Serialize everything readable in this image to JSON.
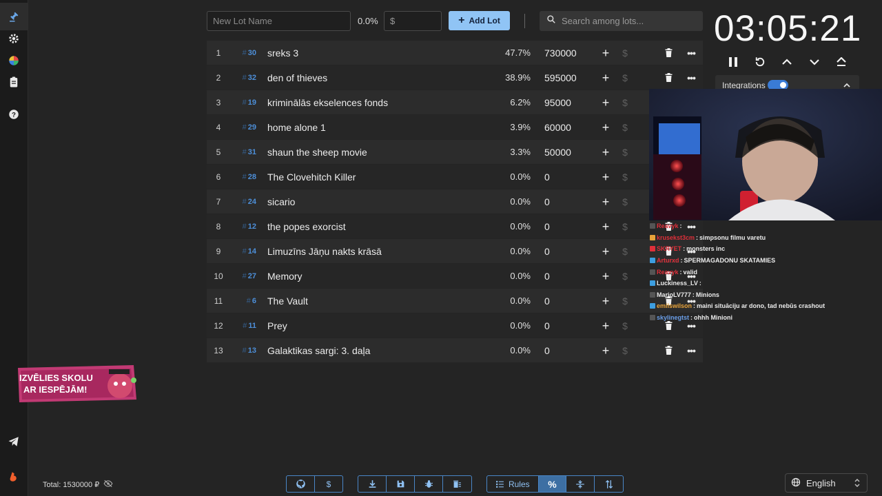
{
  "toolbar": {
    "lot_name_placeholder": "New Lot Name",
    "percent": "0.0%",
    "amount_placeholder": "$",
    "add_lot_label": "Add Lot",
    "search_placeholder": "Search among lots..."
  },
  "timer": {
    "display": "03:05:21"
  },
  "integrations": {
    "label": "Integrations",
    "enabled": true
  },
  "lots": [
    {
      "index": "1",
      "id": "30",
      "name": "sreks 3",
      "percent": "47.7%",
      "amount": "730000"
    },
    {
      "index": "2",
      "id": "32",
      "name": "den of thieves",
      "percent": "38.9%",
      "amount": "595000"
    },
    {
      "index": "3",
      "id": "19",
      "name": "kriminālās ekselences fonds",
      "percent": "6.2%",
      "amount": "95000"
    },
    {
      "index": "4",
      "id": "29",
      "name": "home alone 1",
      "percent": "3.9%",
      "amount": "60000"
    },
    {
      "index": "5",
      "id": "31",
      "name": "shaun the sheep movie",
      "percent": "3.3%",
      "amount": "50000"
    },
    {
      "index": "6",
      "id": "28",
      "name": "The Clovehitch Killer",
      "percent": "0.0%",
      "amount": "0"
    },
    {
      "index": "7",
      "id": "24",
      "name": "sicario",
      "percent": "0.0%",
      "amount": "0"
    },
    {
      "index": "8",
      "id": "12",
      "name": "the popes exorcist",
      "percent": "0.0%",
      "amount": "0"
    },
    {
      "index": "9",
      "id": "14",
      "name": "Limuzīns Jāņu nakts krāsā",
      "percent": "0.0%",
      "amount": "0"
    },
    {
      "index": "10",
      "id": "27",
      "name": "Memory",
      "percent": "0.0%",
      "amount": "0"
    },
    {
      "index": "11",
      "id": "6",
      "name": "The Vault",
      "percent": "0.0%",
      "amount": "0"
    },
    {
      "index": "12",
      "id": "11",
      "name": "Prey",
      "percent": "0.0%",
      "amount": "0"
    },
    {
      "index": "13",
      "id": "13",
      "name": "Galaktikas sargi: 3. daļa",
      "percent": "0.0%",
      "amount": "0"
    }
  ],
  "chat": [
    {
      "user": "Reavyk",
      "user_color": "#e0303a",
      "message": ""
    },
    {
      "user": "krusekst3cm",
      "user_color": "#e0303a",
      "message": "simpsonu filmu varetu"
    },
    {
      "user": "SKRYET",
      "user_color": "#e0303a",
      "message": "monsters inc"
    },
    {
      "user": "Arturxd",
      "user_color": "#e0303a",
      "message": "SPERMAGADONU SKATAMIES"
    },
    {
      "user": "Reavyk",
      "user_color": "#e0303a",
      "message": "valid"
    },
    {
      "user": "Luckiness_LV",
      "user_color": "#ececec",
      "message": ""
    },
    {
      "user": "MarioLV777",
      "user_color": "#ececec",
      "message": "Minions"
    },
    {
      "user": "emilswilson",
      "user_color": "#e8a33a",
      "message": "maini situāciju ar dono, tad nebūs crashout"
    },
    {
      "user": "skylinegtst",
      "user_color": "#6a9ee8",
      "message": "ohhh Minioni"
    }
  ],
  "promo": {
    "line1": "IZVĒLIES SKOLU",
    "line2": "AR IESPĒJĀM!"
  },
  "footer": {
    "total": "Total: 1530000 ₽",
    "rules_label": "Rules",
    "language": "English"
  },
  "colors": {
    "accent": "#90c4f5",
    "id_blue": "#4d8fd9",
    "background": "#242424"
  }
}
